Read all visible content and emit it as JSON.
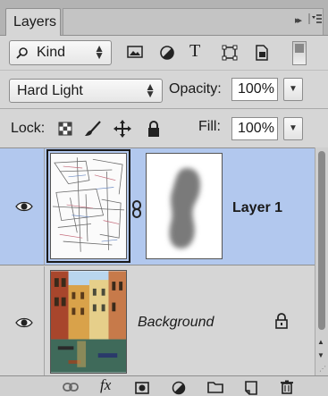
{
  "panel": {
    "tab_label": "Layers",
    "collapse_glyph": "▸▸",
    "menu_icon": "panel-menu-icon"
  },
  "filter": {
    "kind_label": "Kind",
    "search_icon": "search-icon",
    "type_glyph": "T",
    "icons": [
      "pixel-filter-icon",
      "adjustment-filter-icon",
      "type-filter-icon",
      "shape-filter-icon",
      "smart-object-filter-icon",
      "filter-toggle-switch"
    ]
  },
  "blend": {
    "mode": "Hard Light",
    "opacity_label": "Opacity:",
    "opacity_value": "100%"
  },
  "lock": {
    "label": "Lock:",
    "icons": [
      "lock-transparent-pixels-icon",
      "lock-image-pixels-icon",
      "lock-position-icon",
      "lock-all-icon"
    ],
    "fill_label": "Fill:",
    "fill_value": "100%"
  },
  "layers": [
    {
      "name": "Layer 1",
      "selected": true,
      "visible": true,
      "has_mask": true
    },
    {
      "name": "Background",
      "selected": false,
      "visible": true,
      "locked": true
    }
  ],
  "footer": {
    "fx_label": "fx",
    "icons": [
      "link-layers-icon",
      "add-layer-style-icon",
      "add-mask-icon",
      "adjustment-layer-icon",
      "new-group-icon",
      "new-layer-icon",
      "delete-layer-icon"
    ]
  },
  "colors": {
    "selected_row": "#b2c8ee",
    "panel_bg": "#d6d6d6"
  }
}
